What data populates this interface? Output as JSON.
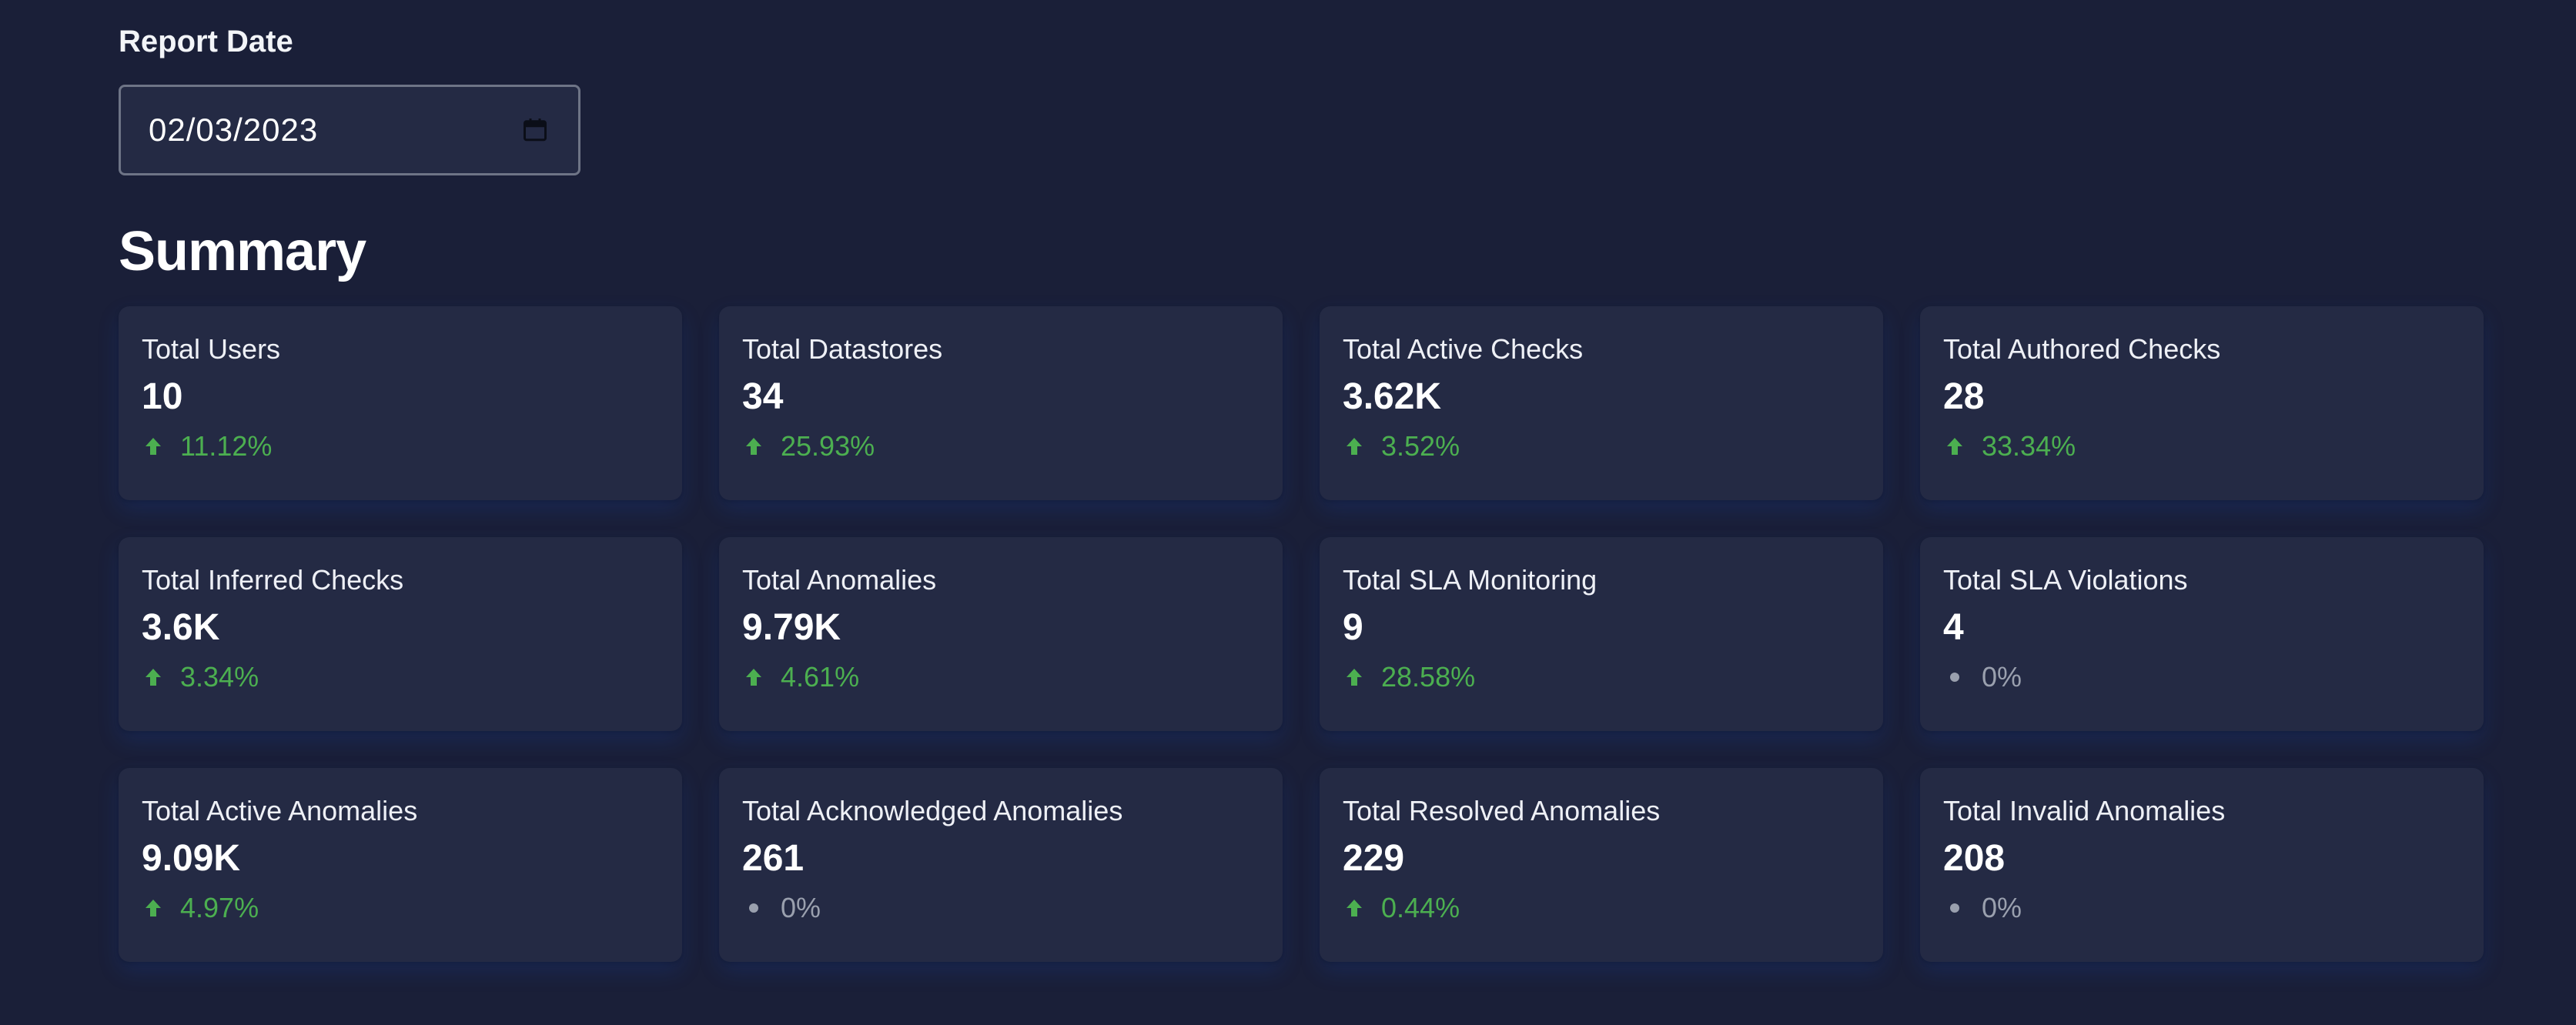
{
  "report_date": {
    "label": "Report Date",
    "value": "02/03/2023",
    "icon": "calendar-icon"
  },
  "summary": {
    "title": "Summary",
    "colors": {
      "up": "#4caf50",
      "flat": "#9aa0ae"
    },
    "cards": [
      {
        "label": "Total Users",
        "value": "10",
        "change": "11.12%",
        "trend": "up"
      },
      {
        "label": "Total Datastores",
        "value": "34",
        "change": "25.93%",
        "trend": "up"
      },
      {
        "label": "Total Active Checks",
        "value": "3.62K",
        "change": "3.52%",
        "trend": "up"
      },
      {
        "label": "Total Authored Checks",
        "value": "28",
        "change": "33.34%",
        "trend": "up"
      },
      {
        "label": "Total Inferred Checks",
        "value": "3.6K",
        "change": "3.34%",
        "trend": "up"
      },
      {
        "label": "Total Anomalies",
        "value": "9.79K",
        "change": "4.61%",
        "trend": "up"
      },
      {
        "label": "Total SLA Monitoring",
        "value": "9",
        "change": "28.58%",
        "trend": "up"
      },
      {
        "label": "Total SLA Violations",
        "value": "4",
        "change": "0%",
        "trend": "flat"
      },
      {
        "label": "Total Active Anomalies",
        "value": "9.09K",
        "change": "4.97%",
        "trend": "up"
      },
      {
        "label": "Total Acknowledged Anomalies",
        "value": "261",
        "change": "0%",
        "trend": "flat"
      },
      {
        "label": "Total Resolved Anomalies",
        "value": "229",
        "change": "0.44%",
        "trend": "up"
      },
      {
        "label": "Total Invalid Anomalies",
        "value": "208",
        "change": "0%",
        "trend": "flat"
      }
    ]
  }
}
